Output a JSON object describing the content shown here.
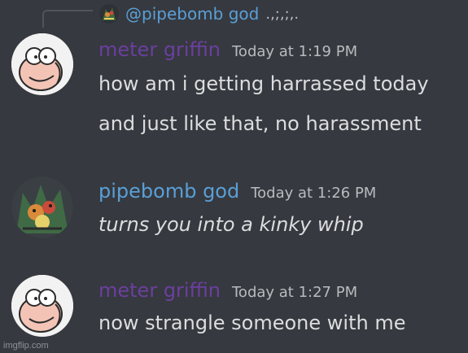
{
  "reply": {
    "author": "@pipebomb god",
    "text": ".,;,;,."
  },
  "messages": [
    {
      "author": "meter griffin",
      "author_color": "#6b3fa0",
      "timestamp": "Today at 1:19 PM",
      "avatar_icon": "peter-griffin-avatar",
      "lines": [
        "how am i getting harrassed today",
        "and just like that, no harassment"
      ]
    },
    {
      "author": "pipebomb god",
      "author_color": "#5a9fd6",
      "timestamp": "Today at 1:26 PM",
      "avatar_icon": "creature-avatar",
      "lines": [
        "turns you into a kinky whip"
      ]
    },
    {
      "author": "meter griffin",
      "author_color": "#6b3fa0",
      "timestamp": "Today at 1:27 PM",
      "avatar_icon": "peter-griffin-avatar",
      "lines": [
        "now strangle someone with me"
      ]
    }
  ],
  "watermark": "imgflip.com"
}
